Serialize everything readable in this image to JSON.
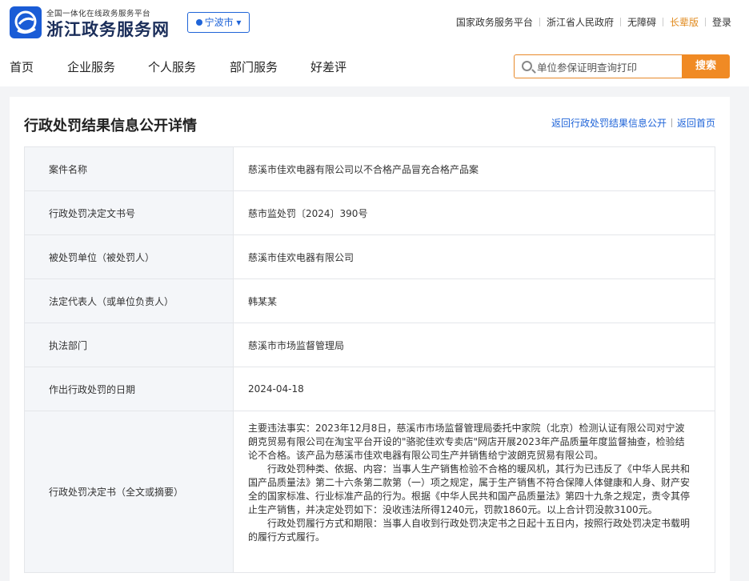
{
  "header": {
    "logo_small": "全国一体化在线政务服务平台",
    "logo_big": "浙江政务服务网",
    "city": "宁波市",
    "links": [
      "国家政务服务平台",
      "浙江省人民政府",
      "无障碍",
      "长辈版",
      "登录"
    ]
  },
  "nav": {
    "items": [
      "首页",
      "企业服务",
      "个人服务",
      "部门服务",
      "好差评"
    ],
    "search_placeholder": "单位参保证明查询打印",
    "search_button": "搜索"
  },
  "page": {
    "title": "行政处罚结果信息公开详情",
    "back_link_1": "返回行政处罚结果信息公开",
    "back_link_2": "返回首页"
  },
  "details": [
    {
      "label": "案件名称",
      "value": "慈溪市佳欢电器有限公司以不合格产品冒充合格产品案"
    },
    {
      "label": "行政处罚决定文书号",
      "value": "慈市监处罚〔2024〕390号"
    },
    {
      "label": "被处罚单位（被处罚人）",
      "value": "慈溪市佳欢电器有限公司"
    },
    {
      "label": "法定代表人（或单位负责人）",
      "value": "韩某某"
    },
    {
      "label": "执法部门",
      "value": "慈溪市市场监督管理局"
    },
    {
      "label": "作出行政处罚的日期",
      "value": "2024-04-18"
    }
  ],
  "decision": {
    "label": "行政处罚决定书（全文或摘要）",
    "p1": "主要违法事实：2023年12月8日，慈溪市市场监督管理局委托中家院（北京）检测认证有限公司对宁波朗克贸易有限公司在淘宝平台开设的\"骆驼佳欢专卖店\"网店开展2023年产品质量年度监督抽查，检验结论不合格。该产品为慈溪市佳欢电器有限公司生产并销售给宁波朗克贸易有限公司。",
    "p2": "行政处罚种类、依据、内容：当事人生产销售检验不合格的暖风机，其行为已违反了《中华人民共和国产品质量法》第二十六条第二款第（一）项之规定，属于生产销售不符合保障人体健康和人身、财产安全的国家标准、行业标准产品的行为。根据《中华人民共和国产品质量法》第四十九条之规定，责令其停止生产销售，并决定处罚如下：没收违法所得1240元，罚款1860元。以上合计罚没款3100元。",
    "p3": "行政处罚履行方式和期限：当事人自收到行政处罚决定书之日起十五日内，按照行政处罚决定书载明的履行方式履行。"
  },
  "colors": {
    "brand_blue": "#1f64d8",
    "accent_orange": "#f08a24"
  }
}
